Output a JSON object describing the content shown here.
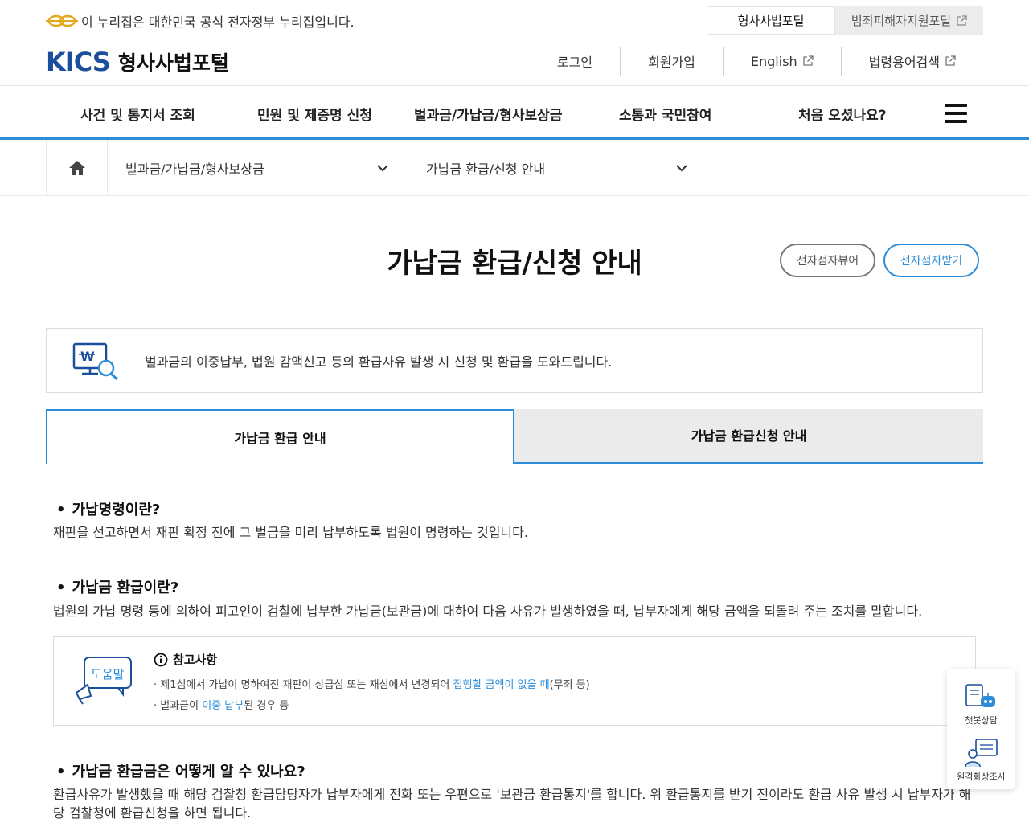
{
  "gov_banner": {
    "text": "이 누리집은 대한민국 공식 전자정부 누리집입니다."
  },
  "portal_tabs": [
    {
      "label": "형사사법포털"
    },
    {
      "label": "범죄피해자지원포털"
    }
  ],
  "brand": {
    "logo": "KICS",
    "name": "형사사법포털"
  },
  "util_links": [
    {
      "label": "로그인"
    },
    {
      "label": "회원가입"
    },
    {
      "label": "English"
    },
    {
      "label": "법령용어검색"
    }
  ],
  "gnb": [
    {
      "label": "사건 및 통지서 조회"
    },
    {
      "label": "민원 및 제증명 신청"
    },
    {
      "label": "벌과금/가납금/형사보상금"
    },
    {
      "label": "소통과 국민참여"
    },
    {
      "label": "처음 오셨나요?"
    }
  ],
  "breadcrumb": {
    "level1": "벌과금/가납금/형사보상금",
    "level2": "가납금 환급/신청 안내"
  },
  "page": {
    "title": "가납금 환급/신청 안내",
    "viewer_button": "전자점자뷰어",
    "receive_button": "전자점자받기"
  },
  "info": {
    "text": "벌과금의 이중납부, 법원 감액신고 등의 환급사유 발생 시 신청 및 환급을 도와드립니다."
  },
  "tabs": [
    {
      "label": "가납금 환급 안내"
    },
    {
      "label": "가납금 환급신청 안내"
    }
  ],
  "sections": {
    "s1_title": "가납명령이란?",
    "s1_body": "재판을 선고하면서 재판 확정 전에 그 벌금을 미리 납부하도록 법원이 명령하는 것입니다.",
    "s2_title": "가납금 환급이란?",
    "s2_body": "법원의 가납 명령 등에 의하여 피고인이 검찰에 납부한 가납금(보관금)에 대하여 다음 사유가 발생하였을 때, 납부자에게 해당 금액을 되돌려 주는 조치를 말합니다.",
    "s3_title": "가납금 환급금은 어떻게 알 수 있나요?",
    "s3_body": "환급사유가 발생했을 때 해당 검찰청 환급담당자가 납부자에게 전화 또는 우편으로 '보관금 환급통지'를 합니다. 위 환급통지를 받기 전이라도 환급 사유 발생 시 납부자가 해당 검찰청에 환급신청을 하면 됩니다."
  },
  "note": {
    "icon_label": "도움말",
    "heading": "참고사항",
    "item1_pre": "· 제1심에서 가납이 명하여진 재판이 상급심 또는 재심에서 변경되어 ",
    "item1_hl": "집행할 금액이 없을 때",
    "item1_post": "(무죄 등)",
    "item2_pre": "· 벌과금이 ",
    "item2_hl": "이중 납부",
    "item2_post": "된 경우 등"
  },
  "floating": {
    "chatbot": "챗봇상담",
    "remote": "원격화상조사"
  },
  "colors": {
    "accent": "#2b8cd8",
    "brand": "#1b4f9c"
  }
}
